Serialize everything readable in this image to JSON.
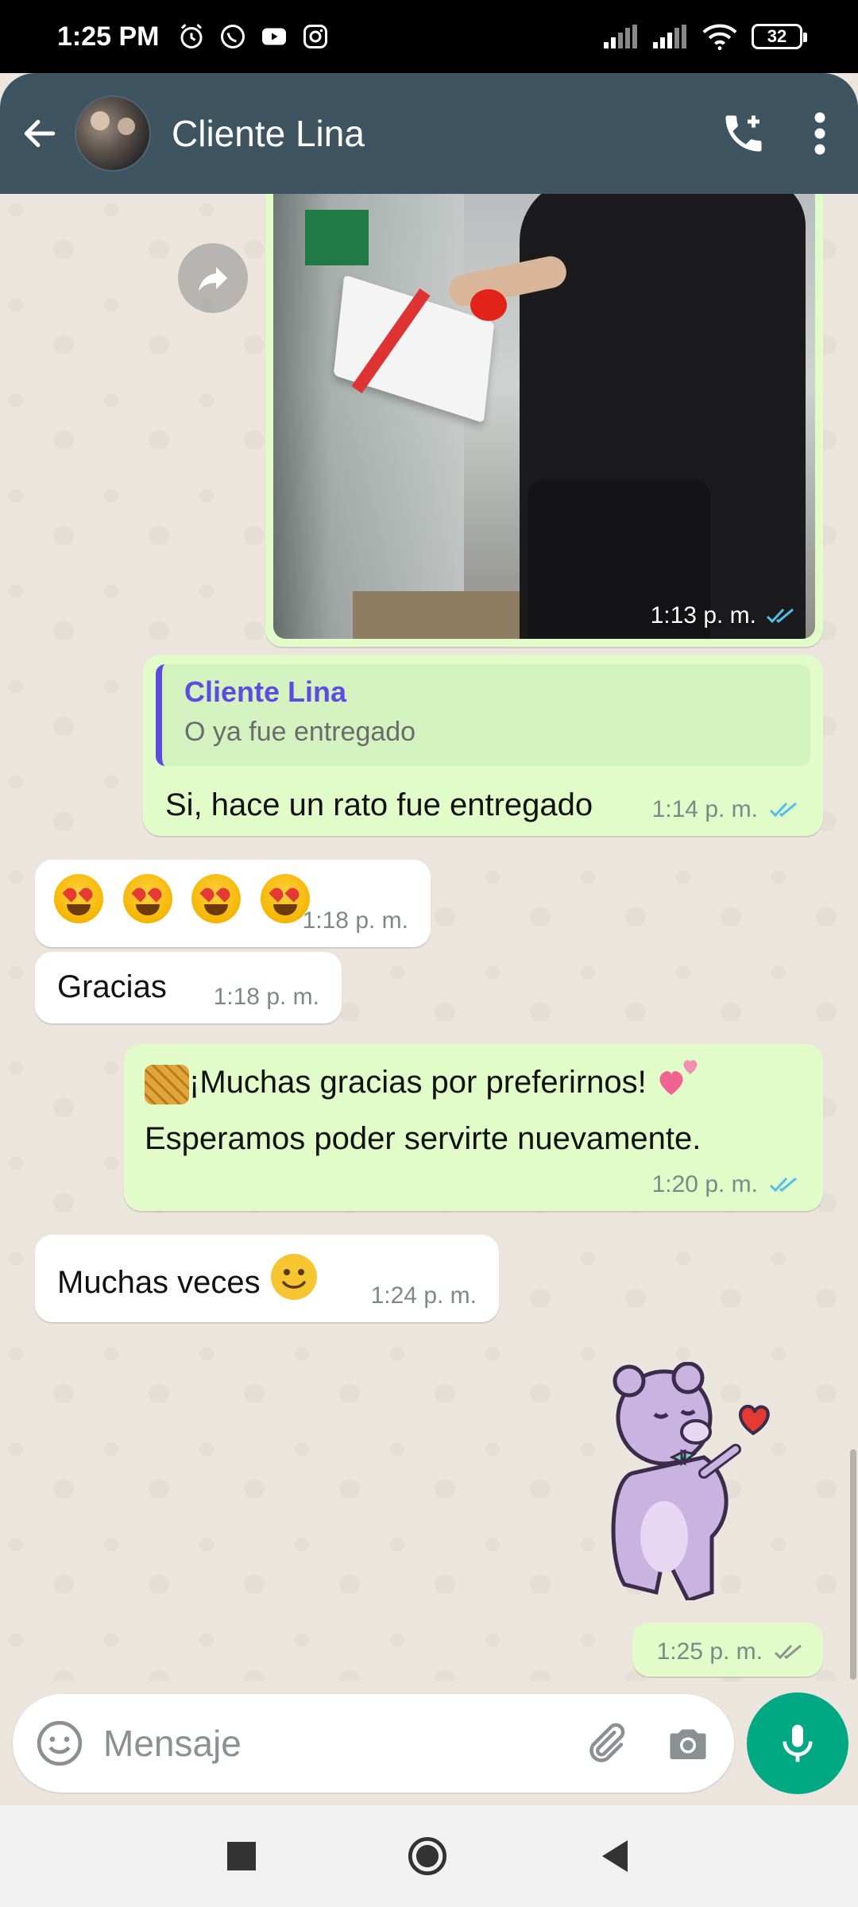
{
  "status_bar": {
    "time": "1:25 PM",
    "battery": "32",
    "icons": [
      "alarm-icon",
      "whatsapp-icon",
      "youtube-icon",
      "instagram-icon",
      "signal-icon",
      "signal-icon",
      "wifi-icon",
      "battery-icon"
    ]
  },
  "header": {
    "contact_name": "Cliente Lina",
    "actions": [
      "add-call-icon",
      "more-vert-icon"
    ]
  },
  "messages": {
    "image": {
      "time": "1:13 p. m.",
      "status": "read"
    },
    "reply": {
      "quoted_name": "Cliente Lina",
      "quoted_text": "O ya fue entregado",
      "text": "Si, hace un rato fue entregado",
      "time": "1:14 p. m."
    },
    "emoji": {
      "time": "1:18 p. m.",
      "count": 4
    },
    "gracias": {
      "text": "Gracias",
      "time": "1:18 p. m."
    },
    "thanks": {
      "line1": "¡Muchas gracias por preferirnos!",
      "line2": "Esperamos poder servirte nuevamente.",
      "time": "1:20 p. m."
    },
    "veces": {
      "text": "Muchas veces",
      "time": "1:24 p. m."
    },
    "sticker": {
      "time": "1:25 p. m."
    }
  },
  "composer": {
    "placeholder": "Mensaje"
  },
  "colors": {
    "header": "#3E5460",
    "outgoing": "#E2FCC9",
    "incoming": "#FFFFFF",
    "accent": "#00A884",
    "read_tick": "#53BDEB"
  }
}
